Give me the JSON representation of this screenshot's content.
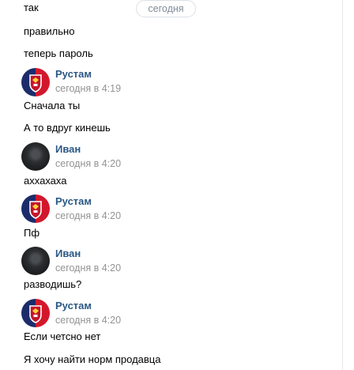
{
  "date_separator": "сегодня",
  "messages_top": [
    {
      "text": "так"
    },
    {
      "text": "правильно"
    },
    {
      "text": "теперь пароль"
    }
  ],
  "groups": [
    {
      "author": "Рустам",
      "time": "сегодня в 4:19",
      "avatar": "cska-logo",
      "lines": [
        "Сначала ты",
        "А то вдруг кинешь"
      ]
    },
    {
      "author": "Иван",
      "time": "сегодня в 4:20",
      "avatar": "dark-photo",
      "lines": [
        "аххахаха"
      ]
    },
    {
      "author": "Рустам",
      "time": "сегодня в 4:20",
      "avatar": "cska-logo",
      "lines": [
        "Пф"
      ]
    },
    {
      "author": "Иван",
      "time": "сегодня в 4:20",
      "avatar": "dark-photo",
      "lines": [
        "разводишь?"
      ]
    },
    {
      "author": "Рустам",
      "time": "сегодня в 4:20",
      "avatar": "cska-logo",
      "lines": [
        "Если четсно нет",
        "Я хочу найти норм продавца"
      ]
    }
  ]
}
